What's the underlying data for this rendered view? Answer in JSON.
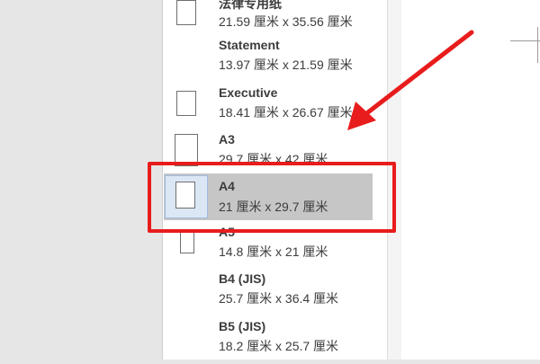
{
  "paper_sizes": [
    {
      "name": "法律专用纸",
      "dims": "21.59 厘米 x 35.56 厘米"
    },
    {
      "name": "Statement",
      "dims": "13.97 厘米 x 21.59 厘米"
    },
    {
      "name": "Executive",
      "dims": "18.41 厘米 x 26.67 厘米"
    },
    {
      "name": "A3",
      "dims": "29.7 厘米 x 42 厘米"
    },
    {
      "name": "A4",
      "dims": "21 厘米 x 29.7 厘米"
    },
    {
      "name": "A5",
      "dims": "14.8 厘米 x 21 厘米"
    },
    {
      "name": "B4 (JIS)",
      "dims": "25.7 厘米 x 36.4 厘米"
    },
    {
      "name": "B5 (JIS)",
      "dims": "18.2 厘米 x 25.7 厘米"
    }
  ],
  "selected_index": 4,
  "colors": {
    "annotation": "#e81c1c",
    "selection": "#c6c6c6"
  }
}
